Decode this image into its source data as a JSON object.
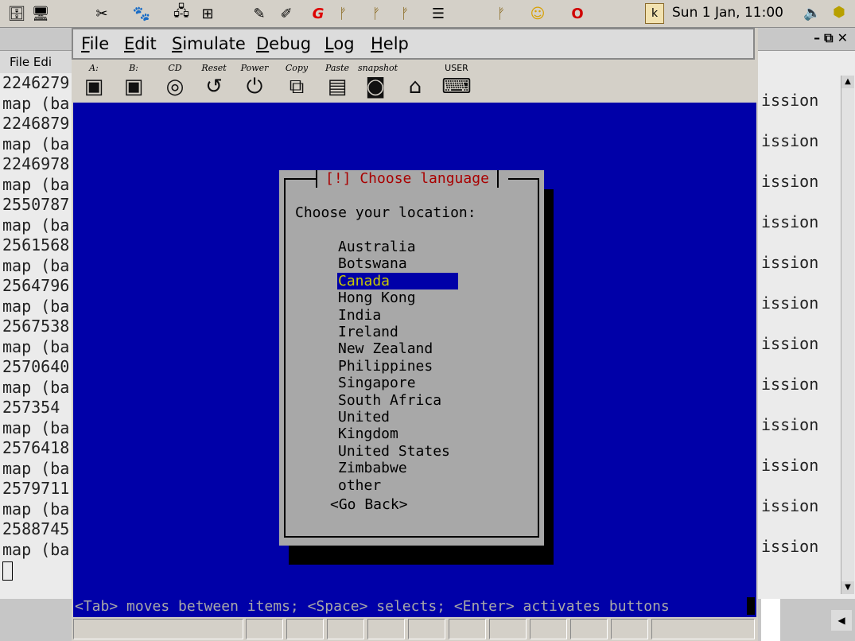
{
  "panel": {
    "icons": [
      "file-cabinet-icon",
      "terminal-icon",
      "scissors-icon",
      "gimp-icon",
      "network-icon",
      "windows-logo-icon",
      "text-editor-icon",
      "image-editor-icon",
      "g-icon",
      "lizard-icon",
      "lizard-icon",
      "lizard-icon",
      "settings-icon",
      "lizard-icon",
      "user-icon",
      "opera-icon"
    ],
    "notes_icon_label": "k",
    "clock": "Sun  1 Jan, 11:00"
  },
  "left_terminal": {
    "menu": "File  Edi",
    "lines": [
      "2246279",
      "map (ba",
      "2246879",
      "map (ba",
      "2246978",
      "map (ba",
      "2550787",
      "map (ba",
      "2561568",
      "map (ba",
      "2564796",
      "map (ba",
      "2567538",
      "map (ba",
      "2570640",
      "map (ba",
      "257354",
      "map (ba",
      "2576418",
      "map (ba",
      "2579711",
      "map (ba",
      "2588745",
      "map (ba"
    ]
  },
  "right_terminal": {
    "controls": "–⧉✕",
    "lines": [
      "ission",
      "ission",
      "ission",
      "ission",
      "ission",
      "ission",
      "ission",
      "ission",
      "ission",
      "ission",
      "ission",
      "ission"
    ]
  },
  "bochs": {
    "menu": {
      "file": {
        "u": "F",
        "rest": "ile"
      },
      "edit": {
        "u": "E",
        "rest": "dit"
      },
      "simulate": {
        "u": "S",
        "rest": "imulate"
      },
      "debug": {
        "u": "D",
        "rest": "ebug"
      },
      "log": {
        "u": "L",
        "rest": "og"
      },
      "help": {
        "u": "H",
        "rest": "elp"
      }
    },
    "toolbar": {
      "floppy_a": "A:",
      "floppy_b": "B:",
      "cd": "CD",
      "reset": "Reset",
      "power": "Power",
      "copy": "Copy",
      "paste": "Paste",
      "snapshot": "snapshot",
      "user": "USER"
    }
  },
  "installer": {
    "title": "[!] Choose language",
    "prompt": "Choose your location:",
    "locations": [
      "Australia",
      "Botswana",
      "Canada",
      "Hong Kong",
      "India",
      "Ireland",
      "New Zealand",
      "Philippines",
      "Singapore",
      "South Africa",
      "United Kingdom",
      "United States",
      "Zimbabwe",
      "other"
    ],
    "selected_location": "Canada",
    "go_back": "<Go Back>",
    "help_line": "<Tab> moves between items; <Space> selects; <Enter> activates buttons"
  },
  "colors": {
    "screen_bg": "#0000a8",
    "dialog_bg": "#a8a8a8",
    "title_color": "#a80000",
    "selection_fg": "#c8c800"
  }
}
